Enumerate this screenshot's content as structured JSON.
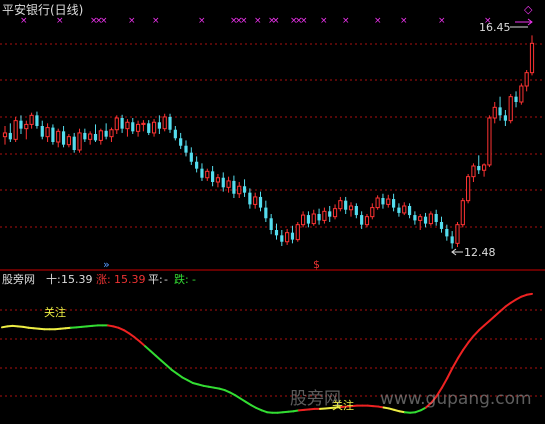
{
  "upper_panel": {
    "title": "平安银行(日线)",
    "high_label": "16.45",
    "low_label": "12.48",
    "buy_marker": "$",
    "arrow_marker": "»",
    "top_icon": "◇"
  },
  "lower_panel": {
    "indicator_name": "股旁网",
    "ten_label": "十:",
    "ten_value": "15.39",
    "rise_label": "涨:",
    "rise_value": "15.39",
    "flat_label": "平:",
    "flat_value": "-",
    "fall_label": "跌:",
    "fall_value": "-",
    "annotations": [
      "关注",
      "关注"
    ]
  },
  "watermark": {
    "site_name": "股旁网",
    "url": "www.gupang.com"
  },
  "colors": {
    "background": "#000000",
    "up": "#ff3333",
    "down": "#55ddee",
    "grid": "#aa1111",
    "divider": "#cc0000",
    "signal": "#ee33ee",
    "curve_yellow": "#eeee44",
    "curve_green": "#33dd33",
    "curve_red": "#ee2222",
    "label_white": "#dddddd"
  },
  "chart_data": [
    {
      "type": "candlestick",
      "title": "平安银行(日线)",
      "annotations": {
        "high": 16.45,
        "low": 12.48
      },
      "ylim": [
        12.2,
        16.7
      ],
      "values": [
        [
          14.55,
          14.75,
          14.4,
          14.62
        ],
        [
          14.62,
          14.8,
          14.45,
          14.5
        ],
        [
          14.5,
          14.92,
          14.45,
          14.85
        ],
        [
          14.85,
          14.95,
          14.6,
          14.7
        ],
        [
          14.7,
          14.85,
          14.5,
          14.78
        ],
        [
          14.78,
          15.0,
          14.7,
          14.95
        ],
        [
          14.95,
          15.02,
          14.7,
          14.75
        ],
        [
          14.75,
          14.85,
          14.5,
          14.55
        ],
        [
          14.55,
          14.8,
          14.45,
          14.72
        ],
        [
          14.72,
          14.78,
          14.4,
          14.45
        ],
        [
          14.45,
          14.7,
          14.35,
          14.65
        ],
        [
          14.65,
          14.75,
          14.35,
          14.4
        ],
        [
          14.4,
          14.6,
          14.35,
          14.55
        ],
        [
          14.55,
          14.62,
          14.25,
          14.3
        ],
        [
          14.3,
          14.7,
          14.25,
          14.62
        ],
        [
          14.62,
          14.7,
          14.45,
          14.5
        ],
        [
          14.5,
          14.65,
          14.4,
          14.6
        ],
        [
          14.6,
          14.78,
          14.45,
          14.48
        ],
        [
          14.48,
          14.7,
          14.4,
          14.66
        ],
        [
          14.66,
          14.8,
          14.5,
          14.55
        ],
        [
          14.55,
          14.72,
          14.45,
          14.68
        ],
        [
          14.68,
          14.95,
          14.6,
          14.9
        ],
        [
          14.9,
          14.96,
          14.62,
          14.7
        ],
        [
          14.7,
          14.88,
          14.55,
          14.82
        ],
        [
          14.82,
          14.9,
          14.6,
          14.65
        ],
        [
          14.65,
          14.85,
          14.55,
          14.78
        ],
        [
          14.78,
          14.86,
          14.65,
          14.8
        ],
        [
          14.8,
          14.86,
          14.58,
          14.62
        ],
        [
          14.62,
          14.88,
          14.55,
          14.82
        ],
        [
          14.82,
          14.95,
          14.6,
          14.7
        ],
        [
          14.7,
          14.98,
          14.65,
          14.92
        ],
        [
          14.92,
          14.98,
          14.62,
          14.68
        ],
        [
          14.68,
          14.75,
          14.48,
          14.52
        ],
        [
          14.52,
          14.62,
          14.32,
          14.38
        ],
        [
          14.38,
          14.48,
          14.18,
          14.25
        ],
        [
          14.25,
          14.35,
          14.02,
          14.08
        ],
        [
          14.08,
          14.18,
          13.88,
          13.95
        ],
        [
          13.95,
          14.05,
          13.72,
          13.78
        ],
        [
          13.78,
          13.95,
          13.72,
          13.9
        ],
        [
          13.9,
          14.0,
          13.62,
          13.7
        ],
        [
          13.7,
          13.85,
          13.6,
          13.78
        ],
        [
          13.78,
          13.88,
          13.52,
          13.6
        ],
        [
          13.6,
          13.8,
          13.5,
          13.72
        ],
        [
          13.72,
          13.82,
          13.4,
          13.48
        ],
        [
          13.48,
          13.7,
          13.4,
          13.62
        ],
        [
          13.62,
          13.75,
          13.42,
          13.5
        ],
        [
          13.5,
          13.58,
          13.2,
          13.28
        ],
        [
          13.28,
          13.5,
          13.2,
          13.42
        ],
        [
          13.42,
          13.52,
          13.15,
          13.22
        ],
        [
          13.22,
          13.35,
          12.95,
          13.02
        ],
        [
          13.02,
          13.1,
          12.72,
          12.8
        ],
        [
          12.8,
          12.92,
          12.62,
          12.7
        ],
        [
          12.7,
          12.8,
          12.5,
          12.58
        ],
        [
          12.58,
          12.82,
          12.52,
          12.75
        ],
        [
          12.75,
          12.88,
          12.55,
          12.62
        ],
        [
          12.62,
          12.95,
          12.58,
          12.9
        ],
        [
          12.9,
          13.15,
          12.85,
          13.08
        ],
        [
          13.08,
          13.15,
          12.85,
          12.92
        ],
        [
          12.92,
          13.18,
          12.88,
          13.1
        ],
        [
          13.1,
          13.2,
          12.9,
          12.98
        ],
        [
          12.98,
          13.22,
          12.92,
          13.15
        ],
        [
          13.15,
          13.25,
          12.95,
          13.05
        ],
        [
          13.05,
          13.28,
          13.0,
          13.2
        ],
        [
          13.2,
          13.42,
          13.15,
          13.35
        ],
        [
          13.35,
          13.42,
          13.1,
          13.18
        ],
        [
          13.18,
          13.32,
          13.05,
          13.25
        ],
        [
          13.25,
          13.3,
          13.02,
          13.08
        ],
        [
          13.08,
          13.15,
          12.82,
          12.9
        ],
        [
          12.9,
          13.1,
          12.85,
          13.05
        ],
        [
          13.05,
          13.3,
          13.0,
          13.22
        ],
        [
          13.22,
          13.45,
          13.18,
          13.4
        ],
        [
          13.4,
          13.48,
          13.2,
          13.28
        ],
        [
          13.28,
          13.46,
          13.22,
          13.38
        ],
        [
          13.38,
          13.48,
          13.15,
          13.22
        ],
        [
          13.22,
          13.3,
          13.05,
          13.12
        ],
        [
          13.12,
          13.32,
          13.08,
          13.25
        ],
        [
          13.25,
          13.3,
          13.02,
          13.08
        ],
        [
          13.08,
          13.15,
          12.9,
          12.98
        ],
        [
          12.98,
          13.1,
          12.8,
          13.05
        ],
        [
          13.05,
          13.12,
          12.85,
          12.92
        ],
        [
          12.92,
          13.15,
          12.88,
          13.1
        ],
        [
          13.1,
          13.18,
          12.88,
          12.95
        ],
        [
          12.95,
          13.05,
          12.75,
          12.82
        ],
        [
          12.82,
          12.9,
          12.6,
          12.68
        ],
        [
          12.68,
          12.78,
          12.45,
          12.55
        ],
        [
          12.55,
          12.95,
          12.48,
          12.9
        ],
        [
          12.9,
          13.4,
          12.85,
          13.35
        ],
        [
          13.35,
          13.85,
          13.3,
          13.8
        ],
        [
          13.8,
          14.05,
          13.7,
          14.0
        ],
        [
          14.0,
          14.2,
          13.85,
          13.92
        ],
        [
          13.92,
          14.05,
          13.8,
          14.02
        ],
        [
          14.02,
          14.95,
          13.98,
          14.9
        ],
        [
          14.9,
          15.2,
          14.8,
          15.1
        ],
        [
          15.1,
          15.3,
          14.85,
          14.95
        ],
        [
          14.95,
          15.05,
          14.75,
          14.85
        ],
        [
          14.85,
          15.35,
          14.8,
          15.3
        ],
        [
          15.3,
          15.4,
          15.1,
          15.2
        ],
        [
          15.2,
          15.55,
          15.15,
          15.5
        ],
        [
          15.5,
          15.8,
          15.4,
          15.75
        ],
        [
          15.75,
          16.45,
          15.7,
          16.3
        ]
      ]
    },
    {
      "type": "line",
      "title": "股旁网",
      "series": [
        {
          "name": "十",
          "values": [
            14.68,
            14.7,
            14.71,
            14.7,
            14.69,
            14.67,
            14.66,
            14.65,
            14.64,
            14.64,
            14.64,
            14.65,
            14.66,
            14.67,
            14.68,
            14.69,
            14.7,
            14.71,
            14.72,
            14.72,
            14.72,
            14.7,
            14.67,
            14.62,
            14.55,
            14.47,
            14.38,
            14.28,
            14.18,
            14.08,
            13.98,
            13.88,
            13.78,
            13.7,
            13.62,
            13.56,
            13.5,
            13.47,
            13.44,
            13.42,
            13.4,
            13.38,
            13.35,
            13.3,
            13.24,
            13.17,
            13.1,
            13.03,
            12.97,
            12.92,
            12.88,
            12.87,
            12.87,
            12.88,
            12.89,
            12.9,
            12.92,
            12.93,
            12.94,
            12.95,
            12.95,
            12.96,
            12.97,
            12.98,
            12.99,
            13.0,
            13.01,
            13.02,
            13.02,
            13.02,
            13.01,
            13.0,
            12.98,
            12.96,
            12.93,
            12.9,
            12.88,
            12.87,
            12.88,
            12.92,
            12.98,
            13.08,
            13.22,
            13.4,
            13.6,
            13.82,
            14.02,
            14.2,
            14.36,
            14.5,
            14.62,
            14.72,
            14.82,
            14.92,
            15.02,
            15.12,
            15.2,
            15.27,
            15.33,
            15.37,
            15.39
          ]
        }
      ]
    }
  ]
}
